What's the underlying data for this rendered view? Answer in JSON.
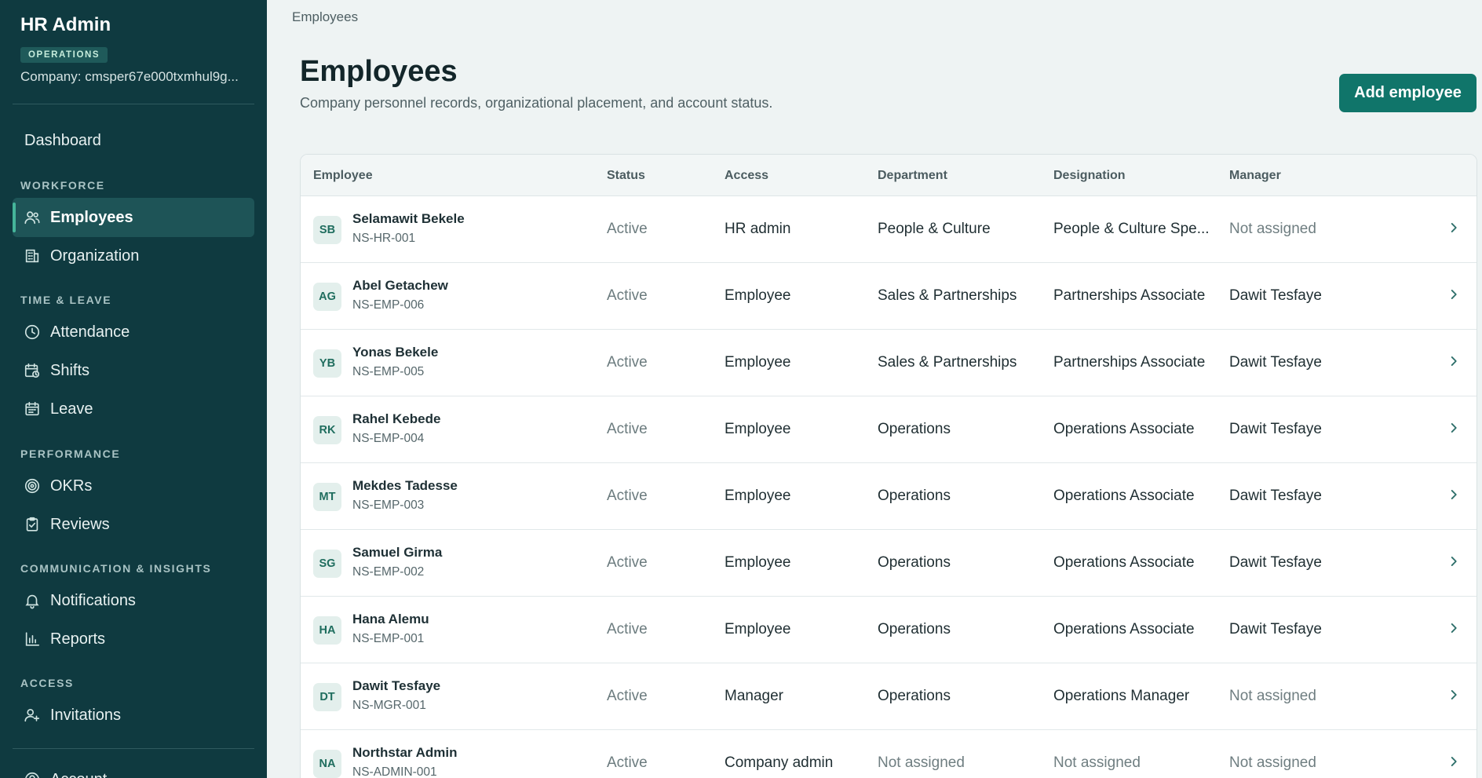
{
  "sidebar": {
    "title": "HR Admin",
    "badge": "OPERATIONS",
    "company": "Company: cmsper67e000txmhul9g...",
    "dashboard": "Dashboard",
    "sections": {
      "workforce": "WORKFORCE",
      "time_leave": "TIME & LEAVE",
      "performance": "PERFORMANCE",
      "communication": "COMMUNICATION & INSIGHTS",
      "access": "ACCESS"
    },
    "items": {
      "employees": "Employees",
      "organization": "Organization",
      "attendance": "Attendance",
      "shifts": "Shifts",
      "leave": "Leave",
      "okrs": "OKRs",
      "reviews": "Reviews",
      "notifications": "Notifications",
      "reports": "Reports",
      "invitations": "Invitations",
      "account": "Account"
    }
  },
  "breadcrumb": "Employees",
  "header": {
    "title": "Employees",
    "subtitle": "Company personnel records, organizational placement, and account status.",
    "add_button": "Add employee"
  },
  "table": {
    "columns": {
      "employee": "Employee",
      "status": "Status",
      "access": "Access",
      "department": "Department",
      "designation": "Designation",
      "manager": "Manager"
    },
    "rows": [
      {
        "initials": "SB",
        "name": "Selamawit Bekele",
        "code": "NS-HR-001",
        "status": "Active",
        "access": "HR admin",
        "department": "People & Culture",
        "designation": "People & Culture Spe...",
        "manager": "Not assigned"
      },
      {
        "initials": "AG",
        "name": "Abel Getachew",
        "code": "NS-EMP-006",
        "status": "Active",
        "access": "Employee",
        "department": "Sales & Partnerships",
        "designation": "Partnerships Associate",
        "manager": "Dawit Tesfaye"
      },
      {
        "initials": "YB",
        "name": "Yonas Bekele",
        "code": "NS-EMP-005",
        "status": "Active",
        "access": "Employee",
        "department": "Sales & Partnerships",
        "designation": "Partnerships Associate",
        "manager": "Dawit Tesfaye"
      },
      {
        "initials": "RK",
        "name": "Rahel Kebede",
        "code": "NS-EMP-004",
        "status": "Active",
        "access": "Employee",
        "department": "Operations",
        "designation": "Operations Associate",
        "manager": "Dawit Tesfaye"
      },
      {
        "initials": "MT",
        "name": "Mekdes Tadesse",
        "code": "NS-EMP-003",
        "status": "Active",
        "access": "Employee",
        "department": "Operations",
        "designation": "Operations Associate",
        "manager": "Dawit Tesfaye"
      },
      {
        "initials": "SG",
        "name": "Samuel Girma",
        "code": "NS-EMP-002",
        "status": "Active",
        "access": "Employee",
        "department": "Operations",
        "designation": "Operations Associate",
        "manager": "Dawit Tesfaye"
      },
      {
        "initials": "HA",
        "name": "Hana Alemu",
        "code": "NS-EMP-001",
        "status": "Active",
        "access": "Employee",
        "department": "Operations",
        "designation": "Operations Associate",
        "manager": "Dawit Tesfaye"
      },
      {
        "initials": "DT",
        "name": "Dawit Tesfaye",
        "code": "NS-MGR-001",
        "status": "Active",
        "access": "Manager",
        "department": "Operations",
        "designation": "Operations Manager",
        "manager": "Not assigned"
      },
      {
        "initials": "NA",
        "name": "Northstar Admin",
        "code": "NS-ADMIN-001",
        "status": "Active",
        "access": "Company admin",
        "department": "Not assigned",
        "designation": "Not assigned",
        "manager": "Not assigned"
      }
    ]
  }
}
